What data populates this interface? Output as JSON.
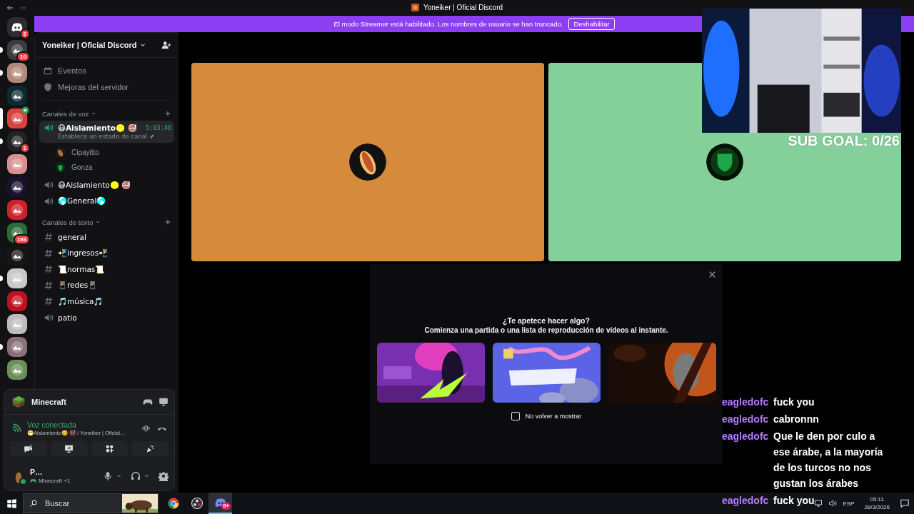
{
  "window": {
    "title": "Yoneiker | Oficial Discord"
  },
  "streamer_banner": {
    "message": "El modo Streamer está habilitado. Los nombres de usuario se han truncado.",
    "button": "Deshabilitar"
  },
  "server_rail": [
    {
      "kind": "home",
      "badge": "2",
      "unread": false,
      "selected": false,
      "in_voice": false
    },
    {
      "kind": "server",
      "color": "#3b3b3d",
      "badge": "10",
      "unread": true,
      "selected": false,
      "in_voice": false
    },
    {
      "kind": "server",
      "color": "#b08a78",
      "unread": true,
      "selected": false,
      "in_voice": false
    },
    {
      "kind": "server",
      "color": "#0d2a33",
      "unread": false,
      "selected": false,
      "in_voice": false
    },
    {
      "kind": "server",
      "color": "#d8433b",
      "unread": false,
      "selected": true,
      "in_voice": true
    },
    {
      "kind": "server",
      "color": "#222224",
      "badge": "1",
      "unread": true,
      "selected": false,
      "in_voice": false
    },
    {
      "kind": "server",
      "color": "#d88f8f",
      "unread": false,
      "selected": false,
      "in_voice": false
    },
    {
      "kind": "server",
      "color": "#1a1030",
      "unread": false,
      "selected": false,
      "in_voice": false
    },
    {
      "kind": "server",
      "color": "#d0202c",
      "unread": false,
      "selected": false,
      "in_voice": false
    },
    {
      "kind": "server",
      "color": "#2d6b3a",
      "badge": "198",
      "unread": false,
      "selected": false,
      "in_voice": false
    },
    {
      "kind": "server",
      "color": "#161616",
      "unread": false,
      "selected": false,
      "in_voice": false
    },
    {
      "kind": "server",
      "color": "#c9c9c9",
      "unread": true,
      "selected": false,
      "in_voice": false
    },
    {
      "kind": "server",
      "color": "#c01020",
      "unread": false,
      "selected": false,
      "in_voice": false
    },
    {
      "kind": "server",
      "color": "#bdbdbd",
      "unread": false,
      "selected": false,
      "in_voice": false
    },
    {
      "kind": "server",
      "color": "#8b6f7a",
      "unread": true,
      "selected": false,
      "in_voice": false
    },
    {
      "kind": "server",
      "color": "#6b8f5a",
      "unread": false,
      "selected": false,
      "in_voice": false
    }
  ],
  "sidebar": {
    "server_name": "Yoneiker | Oficial Discord",
    "menu": [
      {
        "kind": "events",
        "label": "Eventos"
      },
      {
        "kind": "boosts",
        "label": "Mejoras del servidor"
      }
    ],
    "categories": [
      {
        "label": "Canales de voz",
        "channels": [
          {
            "kind": "voice",
            "name": "😷Aislamiento🥴 🚭",
            "selected": true,
            "timer": "5:03:46",
            "status": "Establece un estado de canal",
            "members": [
              {
                "name": "Cipayitto"
              },
              {
                "name": "Gonza"
              }
            ]
          },
          {
            "kind": "voice",
            "name": "😷Aislamiento🥴 🚭",
            "selected": false
          },
          {
            "kind": "voice",
            "name": "🌎General🌎",
            "selected": false
          }
        ]
      },
      {
        "label": "Canales de texto",
        "channels": [
          {
            "kind": "text",
            "name": "general",
            "selected": false
          },
          {
            "kind": "text",
            "name": "📲ingresos📲",
            "selected": false
          },
          {
            "kind": "text",
            "name": "📜normas📜",
            "selected": false
          },
          {
            "kind": "text",
            "name": "📱redes📱",
            "selected": false
          },
          {
            "kind": "text",
            "name": "🎵música🎵",
            "selected": false
          },
          {
            "kind": "voice",
            "name": "patio",
            "selected": false
          }
        ]
      }
    ]
  },
  "activity": {
    "game": "Minecraft"
  },
  "voice": {
    "status": "Voz conectada",
    "channel": "😷Aislamiento🥴 🚭 / Yoneiker | Oficial…"
  },
  "user": {
    "name": "P…",
    "activity": "Minecraft +1",
    "online": true
  },
  "stage": {
    "tiles": [
      {
        "color": "#d68a3c"
      },
      {
        "color": "#85d09a"
      }
    ]
  },
  "overlay": {
    "sub_goal": "SUB GOAL: 0/26"
  },
  "modal": {
    "title": "¿Te apetece hacer algo?",
    "subtitle": "Comienza una partida o una lista de reproducción de vídeos al instante.",
    "checkbox": {
      "label": "No volver a mostrar",
      "checked": false
    }
  },
  "chat": [
    {
      "user": "eagledofc",
      "text": "fuck you"
    },
    {
      "user": "eagledofc",
      "text": "cabronnn"
    },
    {
      "user": "eagledofc",
      "text": "Que le den por culo a ese árabe, a la mayoría de los turcos no nos gustan los árabes"
    },
    {
      "user": "eagledofc",
      "text": "fuck you"
    }
  ],
  "taskbar": {
    "search_placeholder": "Buscar",
    "apps": [
      {
        "kind": "chrome",
        "selected": false
      },
      {
        "kind": "obs",
        "selected": false
      },
      {
        "kind": "discord",
        "selected": true,
        "badge": "9+"
      }
    ],
    "language": "ESP",
    "time": "05:11",
    "date": "28/3/2026"
  }
}
